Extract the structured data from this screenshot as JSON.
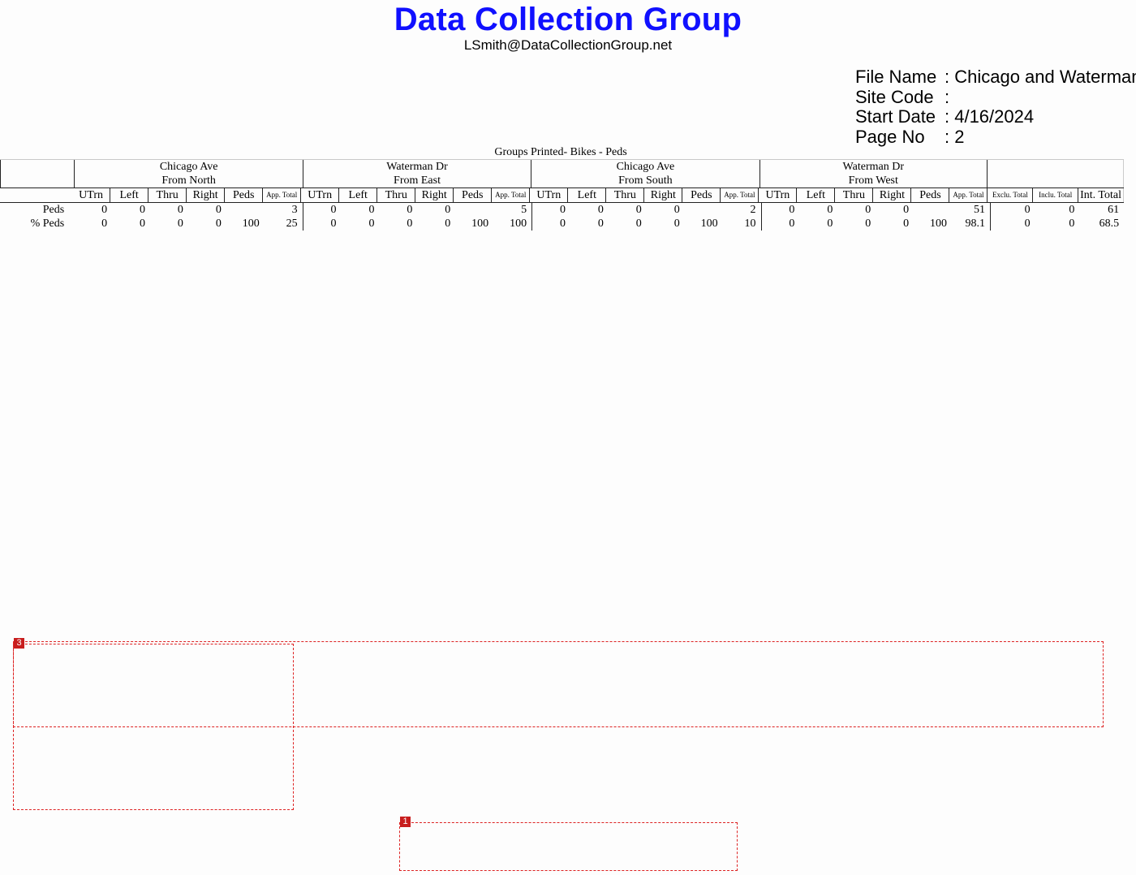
{
  "header": {
    "company": "Data Collection Group",
    "email": "LSmith@DataCollectionGroup.net"
  },
  "meta": [
    {
      "key": "File Name",
      "value": ": Chicago and Waterman"
    },
    {
      "key": "Site Code",
      "value": ":"
    },
    {
      "key": "Start Date",
      "value": ": 4/16/2024"
    },
    {
      "key": "Page No",
      "value": ": 2"
    }
  ],
  "groups_printed": "Groups Printed- Bikes - Peds",
  "approaches": [
    {
      "street": "Chicago Ave",
      "direction": "From North"
    },
    {
      "street": "Waterman Dr",
      "direction": "From East"
    },
    {
      "street": "Chicago Ave",
      "direction": "From South"
    },
    {
      "street": "Waterman Dr",
      "direction": "From West"
    }
  ],
  "movement_columns": [
    "UTrn",
    "Left",
    "Thru",
    "Right",
    "Peds",
    "App. Total"
  ],
  "total_columns": [
    "Exclu. Total",
    "Inclu. Total",
    "Int. Total"
  ],
  "rows": [
    {
      "label": "Peds",
      "approaches": [
        [
          "0",
          "0",
          "0",
          "0",
          "",
          "3"
        ],
        [
          "0",
          "0",
          "0",
          "0",
          "",
          "5"
        ],
        [
          "0",
          "0",
          "0",
          "0",
          "",
          "2"
        ],
        [
          "0",
          "0",
          "0",
          "0",
          "",
          "51"
        ]
      ],
      "totals": [
        "0",
        "0",
        "61"
      ]
    },
    {
      "label": "% Peds",
      "approaches": [
        [
          "0",
          "0",
          "0",
          "0",
          "100",
          "25"
        ],
        [
          "0",
          "0",
          "0",
          "0",
          "100",
          "100"
        ],
        [
          "0",
          "0",
          "0",
          "0",
          "100",
          "10"
        ],
        [
          "0",
          "0",
          "0",
          "0",
          "100",
          "98.1"
        ]
      ],
      "totals": [
        "0",
        "0",
        "68.5"
      ]
    }
  ],
  "overlay_tags": [
    "3",
    "1"
  ]
}
